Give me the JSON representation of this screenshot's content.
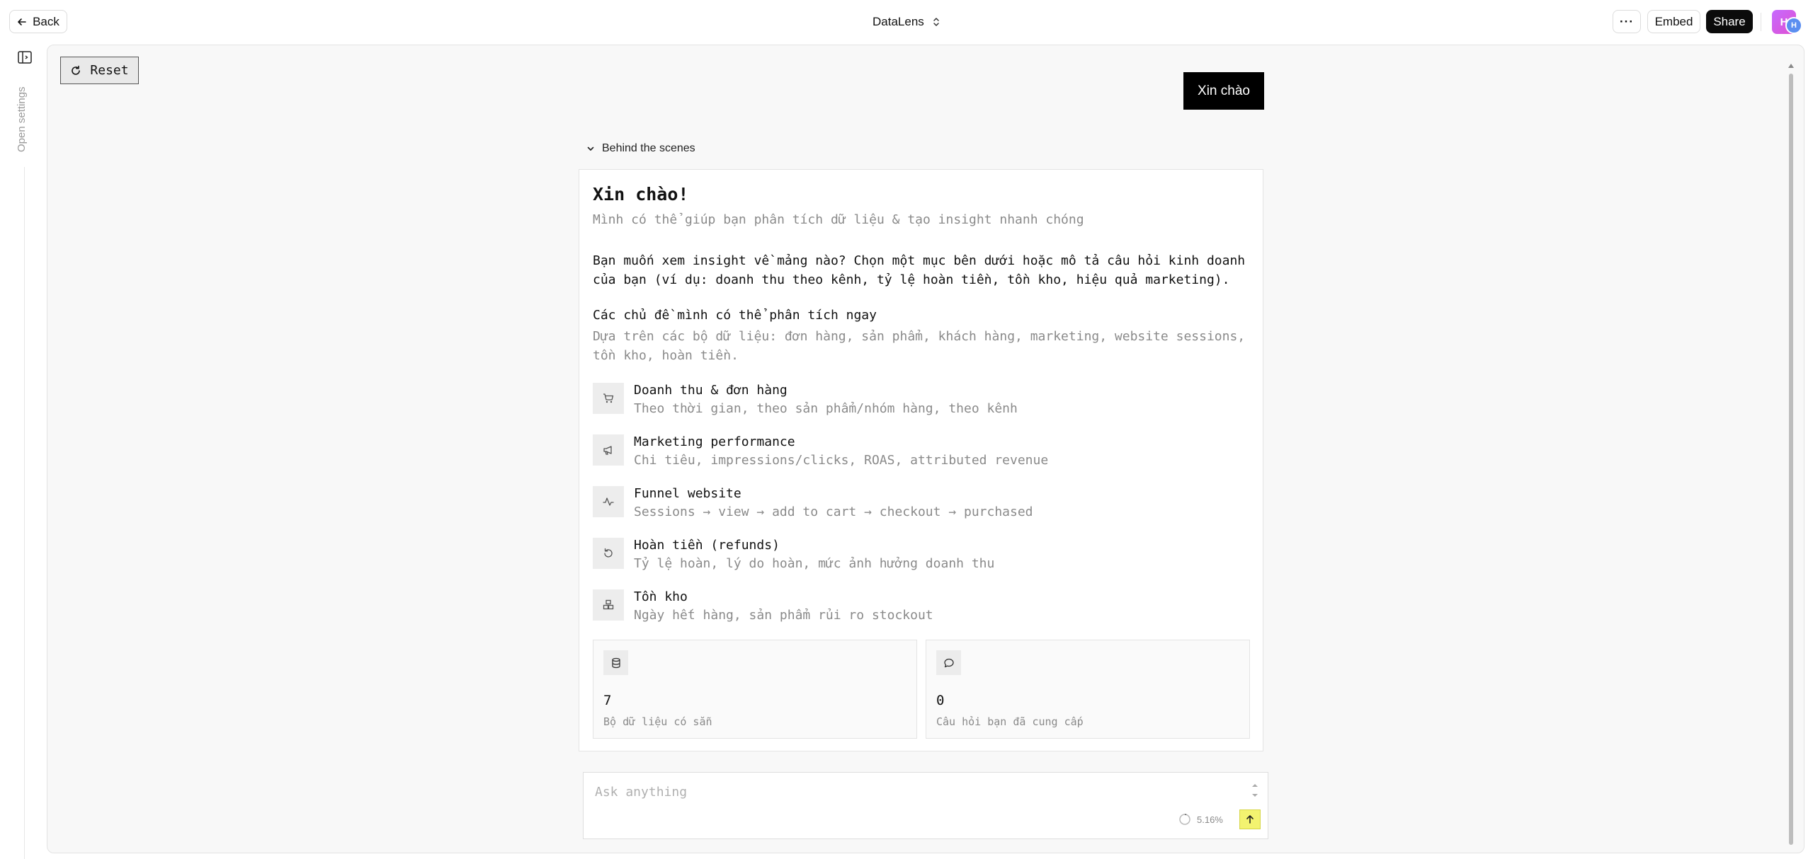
{
  "topbar": {
    "back_label": "Back",
    "app_title": "DataLens",
    "more_label": "···",
    "embed_label": "Embed",
    "share_label": "Share",
    "avatar_initial": "H",
    "avatar_badge": "H"
  },
  "sidebar": {
    "toggle_icon": "sidebar-panel-icon",
    "open_settings_label": "Open settings"
  },
  "canvas": {
    "reset_label": "Reset",
    "user_message": "Xin chào",
    "behind_scenes_label": "Behind the scenes"
  },
  "response": {
    "title": "Xin chào!",
    "subtitle": "Mình có thể giúp bạn phân tích dữ liệu & tạo insight nhanh chóng",
    "prompt": "Bạn muốn xem insight về mảng nào? Chọn một mục bên dưới hoặc mô tả câu hỏi kinh doanh của bạn (ví dụ: doanh thu theo kênh, tỷ lệ hoàn tiền, tồn kho, hiệu quả marketing).",
    "topics_title": "Các chủ đề mình có thể phân tích ngay",
    "topics_subtitle": "Dựa trên các bộ dữ liệu: đơn hàng, sản phẩm, khách hàng, marketing, website sessions, tồn kho, hoàn tiền.",
    "topics": [
      {
        "icon": "cart-icon",
        "title": "Doanh thu & đơn hàng",
        "desc": "Theo thời gian, theo sản phẩm/nhóm hàng, theo kênh"
      },
      {
        "icon": "megaphone-icon",
        "title": "Marketing performance",
        "desc": "Chi tiêu, impressions/clicks, ROAS, attributed revenue"
      },
      {
        "icon": "activity-icon",
        "title": "Funnel website",
        "desc": "Sessions → view → add to cart → checkout → purchased"
      },
      {
        "icon": "undo-icon",
        "title": "Hoàn tiền (refunds)",
        "desc": "Tỷ lệ hoàn, lý do hoàn, mức ảnh hưởng doanh thu"
      },
      {
        "icon": "boxes-icon",
        "title": "Tồn kho",
        "desc": "Ngày hết hàng, sản phẩm rủi ro stockout"
      }
    ],
    "stats": [
      {
        "icon": "database-icon",
        "value": "7",
        "label": "Bộ dữ liệu có sẵn"
      },
      {
        "icon": "chat-bubble-icon",
        "value": "0",
        "label": "Câu hỏi bạn đã cung cấp"
      }
    ]
  },
  "composer": {
    "placeholder": "Ask anything",
    "context_usage": "5.16%",
    "send_icon": "arrow-up-icon"
  }
}
